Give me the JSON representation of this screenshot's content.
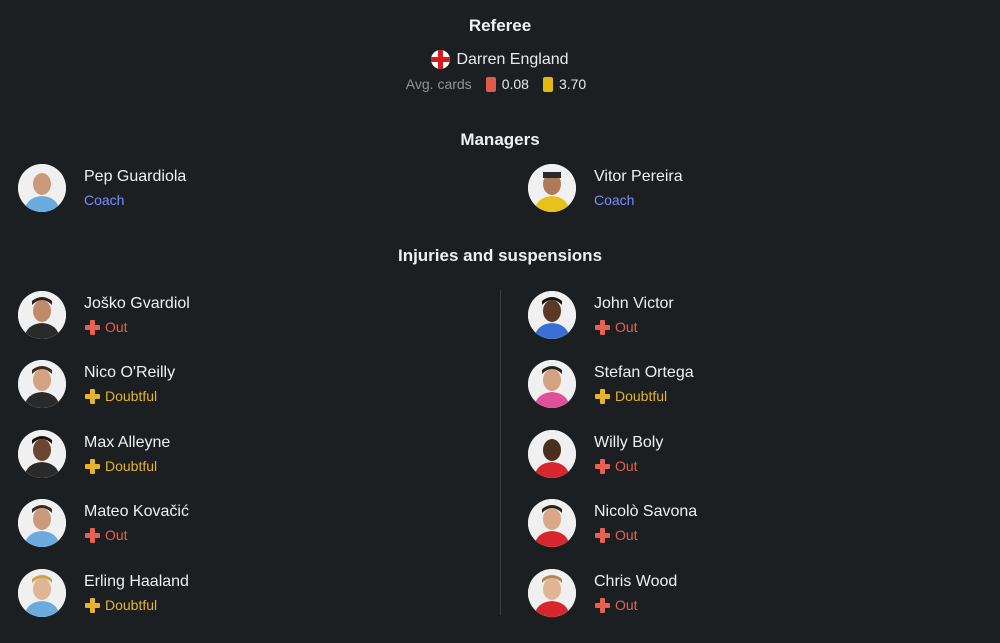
{
  "referee": {
    "title": "Referee",
    "name": "Darren England",
    "flag_icon": "england-flag-icon",
    "avg_cards_label": "Avg. cards",
    "red_avg": "0.08",
    "yellow_avg": "3.70"
  },
  "managers": {
    "title": "Managers",
    "home": {
      "name": "Pep Guardiola",
      "role": "Coach"
    },
    "away": {
      "name": "Vitor Pereira",
      "role": "Coach"
    }
  },
  "injuries": {
    "title": "Injuries and suspensions",
    "home": [
      {
        "name": "Joško Gvardiol",
        "status": "Out",
        "type": "out"
      },
      {
        "name": "Nico O'Reilly",
        "status": "Doubtful",
        "type": "doubtful"
      },
      {
        "name": "Max Alleyne",
        "status": "Doubtful",
        "type": "doubtful"
      },
      {
        "name": "Mateo Kovačić",
        "status": "Out",
        "type": "out"
      },
      {
        "name": "Erling Haaland",
        "status": "Doubtful",
        "type": "doubtful"
      }
    ],
    "away": [
      {
        "name": "John Victor",
        "status": "Out",
        "type": "out"
      },
      {
        "name": "Stefan Ortega",
        "status": "Doubtful",
        "type": "doubtful"
      },
      {
        "name": "Willy Boly",
        "status": "Out",
        "type": "out"
      },
      {
        "name": "Nicolò Savona",
        "status": "Out",
        "type": "out"
      },
      {
        "name": "Chris Wood",
        "status": "Out",
        "type": "out"
      }
    ]
  },
  "colors": {
    "background": "#1c1f22",
    "coach_role": "#7b8cff",
    "out": "#e8604f",
    "doubtful": "#e4b42e",
    "red_card": "#e05a4a",
    "yellow_card": "#e4b814"
  }
}
